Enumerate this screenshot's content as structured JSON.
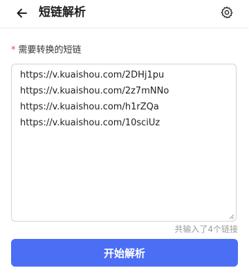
{
  "header": {
    "title": "短链解析",
    "back_icon": "arrow-left-icon",
    "settings_icon": "gear-icon"
  },
  "form": {
    "required_mark": "*",
    "label": "需要转换的短链",
    "links": [
      "https://v.kuaishou.com/2DHj1pu",
      "https://v.kuaishou.com/2z7mNNo",
      "https://v.kuaishou.com/h1rZQa",
      "https://v.kuaishou.com/10sciUz"
    ],
    "count_text": "共输入了4个链接"
  },
  "actions": {
    "submit_label": "开始解析"
  },
  "colors": {
    "primary": "#4c6ef5",
    "required": "#e5484d"
  }
}
